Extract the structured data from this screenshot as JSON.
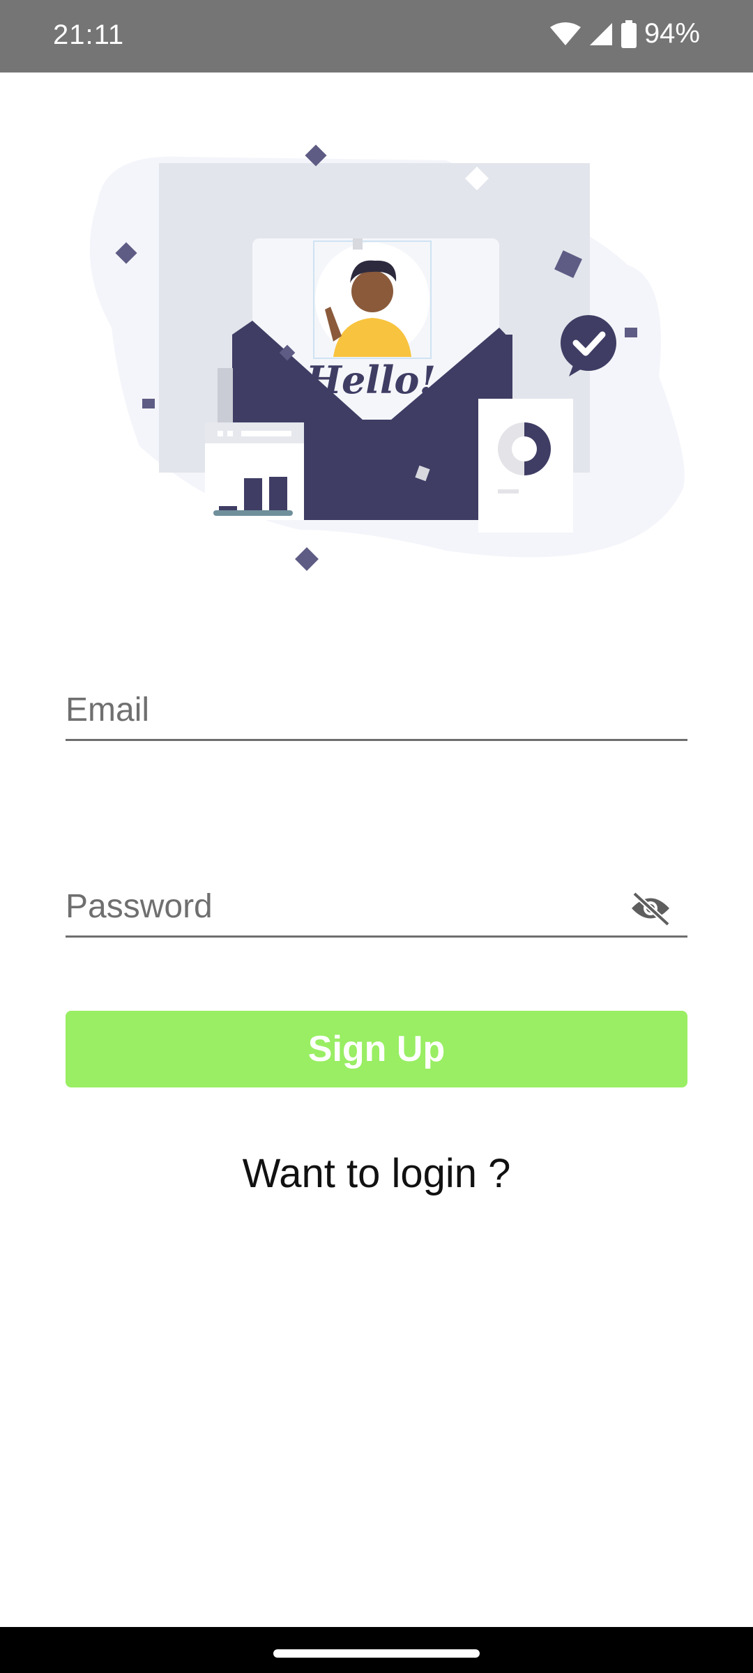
{
  "status_bar": {
    "time": "21:11",
    "battery": "94%",
    "icons": [
      "wifi-icon",
      "signal-icon",
      "battery-icon"
    ]
  },
  "illustration": {
    "greeting": "Hello!"
  },
  "form": {
    "email_placeholder": "Email",
    "email_value": "",
    "password_placeholder": "Password",
    "password_value": "",
    "password_toggle_icon": "eye-off-icon"
  },
  "signup_label": "Sign Up",
  "login_link": "Want to login ?",
  "colors": {
    "button": "#99ee63",
    "illustration_primary": "#3f3d64",
    "accent_yellow": "#f8c33e"
  }
}
